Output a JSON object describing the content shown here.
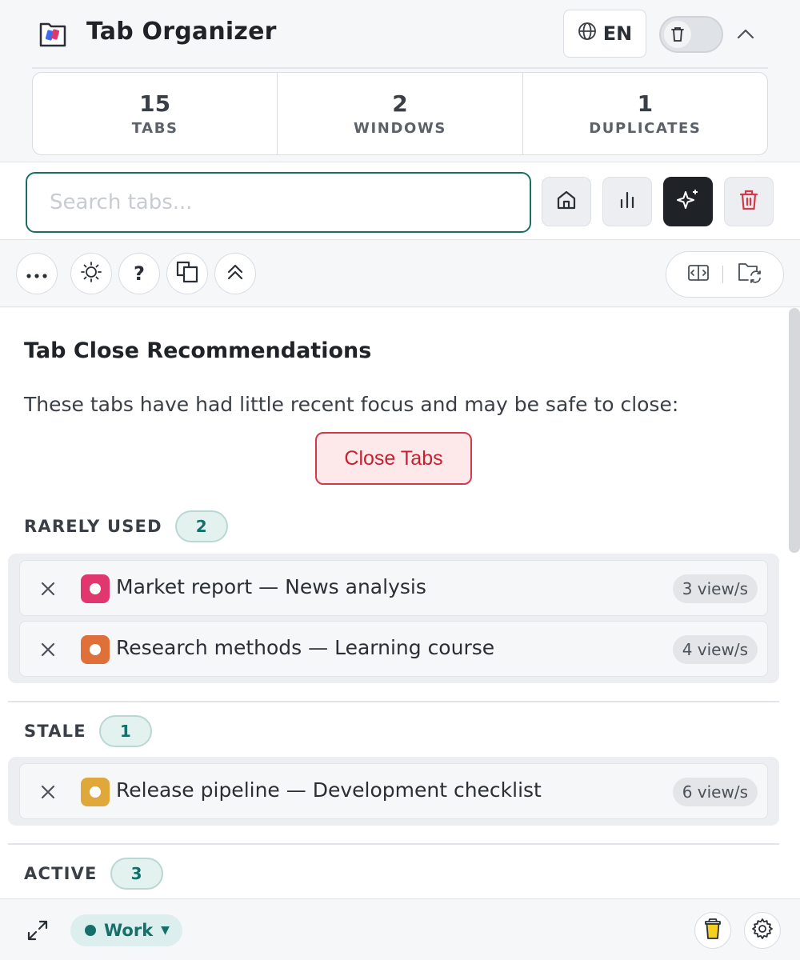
{
  "app": {
    "title": "Tab Organizer"
  },
  "header": {
    "language": "EN",
    "icons": {
      "logo": "logo-icon",
      "globe": "globe-icon",
      "toggle": "trash-icon",
      "collapse": "chevron-up-icon"
    }
  },
  "stats": [
    {
      "value": "15",
      "label": "TABS"
    },
    {
      "value": "2",
      "label": "WINDOWS"
    },
    {
      "value": "1",
      "label": "DUPLICATES"
    }
  ],
  "search": {
    "placeholder": "Search tabs...",
    "value": ""
  },
  "toolbar": {
    "buttons": [
      "home-icon",
      "bar-chart-icon",
      "sparkles-icon",
      "trash-icon"
    ],
    "active": "sparkles-icon"
  },
  "actions": {
    "buttons": [
      "more-icon",
      "sun-icon",
      "help-icon",
      "copy-icon",
      "chevrons-up-icon"
    ],
    "help_glyph": "?",
    "right": [
      "split-view-icon",
      "folder-sync-icon"
    ]
  },
  "recommendations": {
    "title": "Tab Close Recommendations",
    "description": "These tabs have had little recent focus and may be safe to close:",
    "close_button": "Close Tabs",
    "sections": [
      {
        "label": "RARELY USED",
        "count": "2",
        "tabs": [
          {
            "title": "Market report — News analysis",
            "views": "3 view/s",
            "color": "#e0386e"
          },
          {
            "title": "Research methods — Learning course",
            "views": "4 view/s",
            "color": "#e0703a"
          }
        ]
      },
      {
        "label": "STALE",
        "count": "1",
        "tabs": [
          {
            "title": "Release pipeline — Development checklist",
            "views": "6 view/s",
            "color": "#e0a83a"
          }
        ]
      },
      {
        "label": "ACTIVE",
        "count": "3",
        "tabs": []
      }
    ]
  },
  "footer": {
    "workspace": "Work",
    "workspace_color": "#16706a",
    "icons": [
      "expand-icon",
      "coffee-cup-icon",
      "gear-icon"
    ]
  }
}
